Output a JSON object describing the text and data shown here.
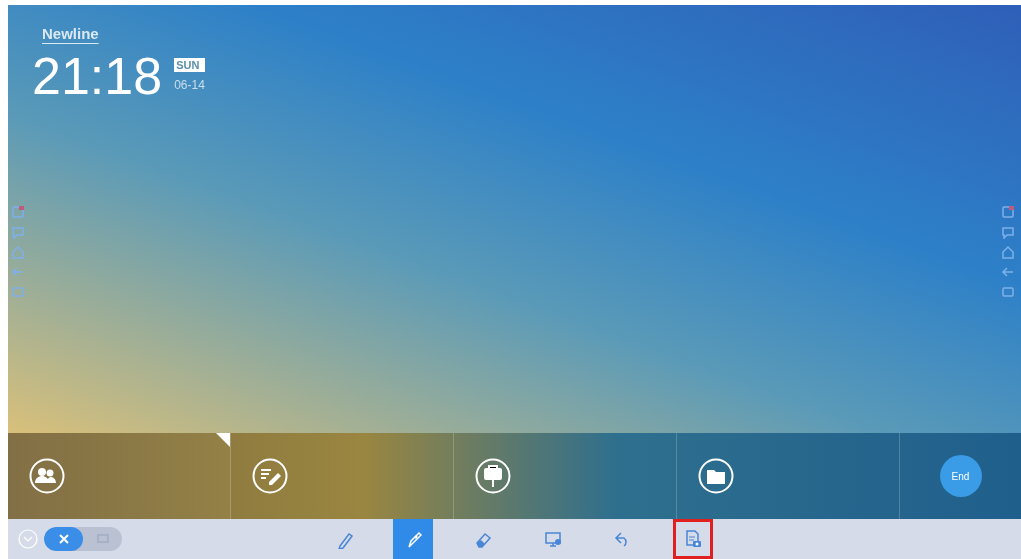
{
  "logo": "Newline",
  "clock": {
    "time": "21:18",
    "day": "SUN",
    "date": "06-14"
  },
  "tiles": [
    {
      "kind": "people",
      "selected": true
    },
    {
      "kind": "notes",
      "selected": false
    },
    {
      "kind": "easel",
      "selected": false
    },
    {
      "kind": "folder",
      "selected": false
    },
    {
      "kind": "end",
      "label": "End",
      "selected": false
    }
  ],
  "toggle": [
    {
      "kind": "touch",
      "selected": true
    },
    {
      "kind": "screen",
      "selected": false
    }
  ],
  "tools": [
    {
      "kind": "pencil",
      "selected": false,
      "highlighted": false
    },
    {
      "kind": "pen",
      "selected": true,
      "highlighted": false
    },
    {
      "kind": "eraser",
      "selected": false,
      "highlighted": false
    },
    {
      "kind": "monitor",
      "selected": false,
      "highlighted": false
    },
    {
      "kind": "undo",
      "selected": false,
      "highlighted": false
    },
    {
      "kind": "screenshot",
      "selected": false,
      "highlighted": true
    }
  ]
}
